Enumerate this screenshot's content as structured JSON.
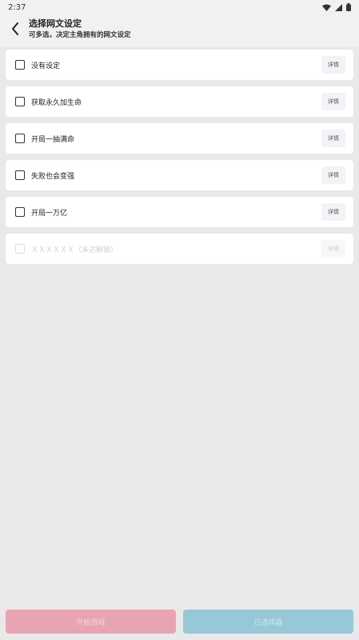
{
  "status": {
    "time": "2:37"
  },
  "header": {
    "title": "选择网文设定",
    "subtitle": "可多选，决定主角拥有的网文设定"
  },
  "items": [
    {
      "label": "没有设定",
      "detail": "详情",
      "disabled": false
    },
    {
      "label": "获取永久加生命",
      "detail": "详情",
      "disabled": false
    },
    {
      "label": "开局一抽满命",
      "detail": "详情",
      "disabled": false
    },
    {
      "label": "失败也会变强",
      "detail": "详情",
      "disabled": false
    },
    {
      "label": "开局一万亿",
      "detail": "详情",
      "disabled": false
    },
    {
      "label": "ＸＸＸＸＸＸ（未达解锁）",
      "detail": "详情",
      "disabled": true
    }
  ],
  "bottom": {
    "left_label": "开始游戏",
    "right_label": "已选择器"
  },
  "colors": {
    "background": "#e9e9e9",
    "left_button": "#e8a4b3",
    "right_button": "#97c8d8"
  }
}
